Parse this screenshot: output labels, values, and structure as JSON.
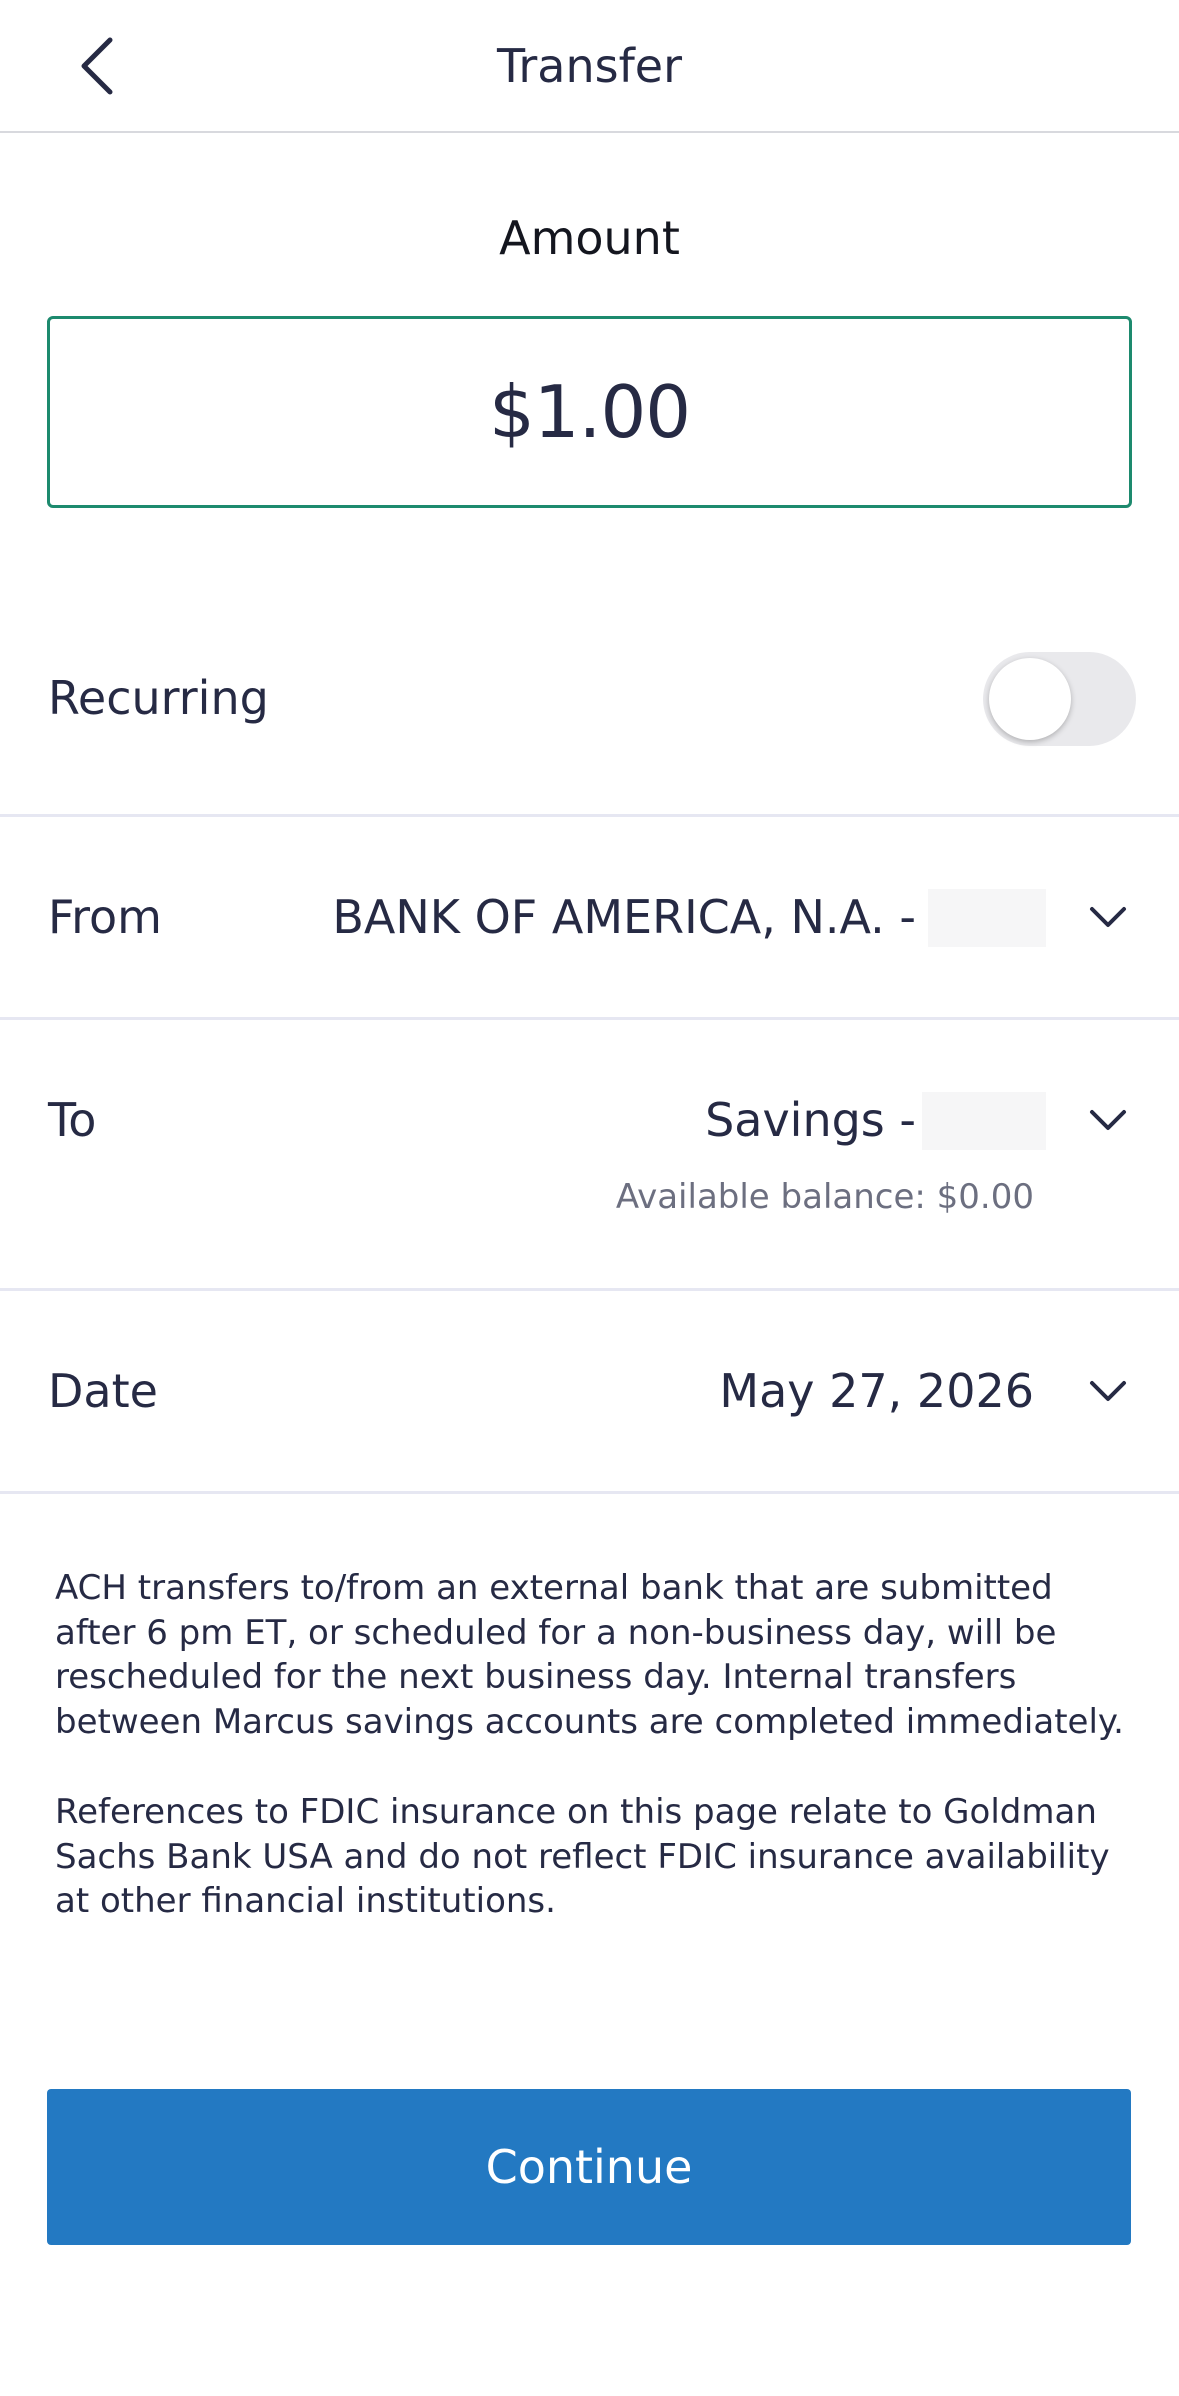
{
  "header": {
    "title": "Transfer",
    "back_icon": "chevron-left-icon"
  },
  "amount": {
    "label": "Amount",
    "value": "$1.00",
    "border_color": "#1d8a6e"
  },
  "recurring": {
    "label": "Recurring",
    "enabled": false
  },
  "from": {
    "label": "From",
    "value": "BANK OF AMERICA, N.A. -"
  },
  "to": {
    "label": "To",
    "value": "Savings -",
    "available_balance": "Available balance: $0.00"
  },
  "date": {
    "label": "Date",
    "value": "May 27, 2026"
  },
  "disclaimers": {
    "ach": "ACH transfers to/from an external bank that are submitted after 6 pm ET, or scheduled for a non-business day, will be rescheduled for the next business day. Internal transfers between Marcus savings accounts are completed immediately.",
    "fdic": "References to FDIC insurance on this page relate to Goldman Sachs Bank USA and do not reflect FDIC insurance availability at other financial institutions."
  },
  "continue_button": {
    "label": "Continue",
    "color": "#2379c2"
  }
}
